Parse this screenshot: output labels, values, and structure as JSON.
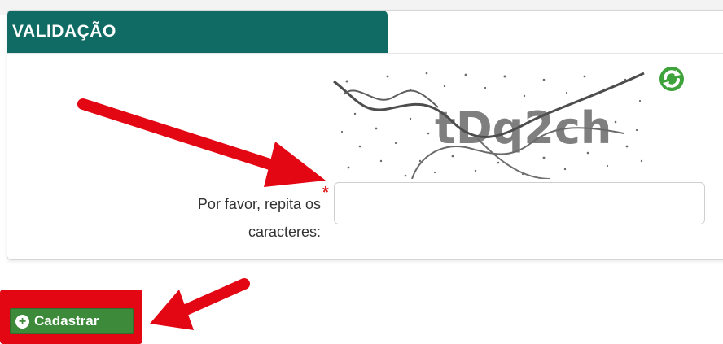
{
  "panel": {
    "title": "VALIDAÇÃO"
  },
  "captcha": {
    "image_text": "tDq2ch",
    "refresh_icon": "refresh-icon",
    "label": "Por favor, repita os caracteres:",
    "required_mark": "*",
    "input_value": "",
    "input_placeholder": ""
  },
  "actions": {
    "submit_label": "Cadastrar",
    "submit_icon": "plus-circle-icon"
  },
  "annotations": {
    "arrow_color": "#e30613",
    "highlight_color": "#e30613"
  },
  "colors": {
    "header": "#0f6b63",
    "button": "#3d8b3a"
  }
}
